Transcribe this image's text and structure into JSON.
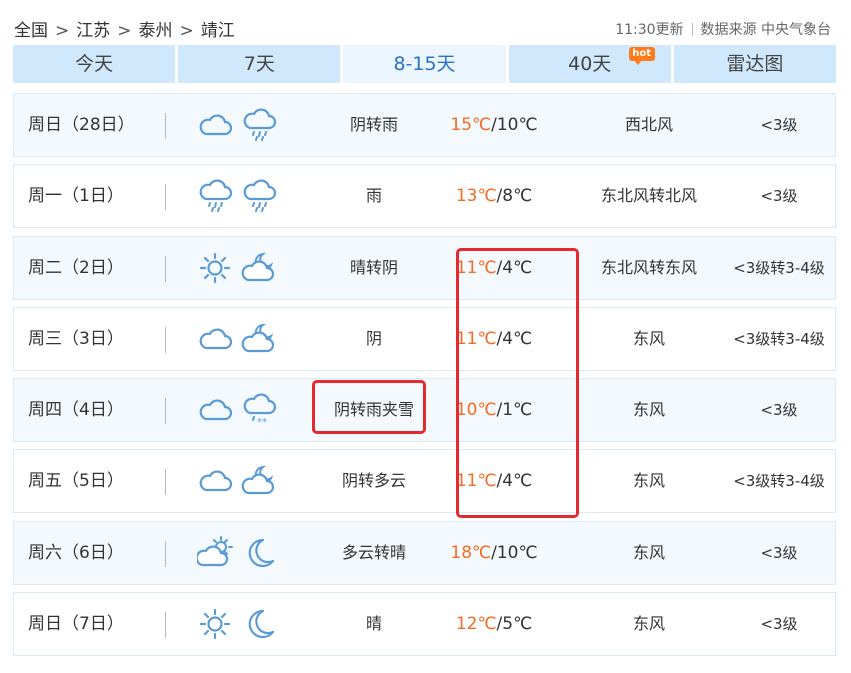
{
  "breadcrumb": [
    "全国",
    "江苏",
    "泰州",
    "靖江"
  ],
  "breadcrumb_sep": ">",
  "meta": {
    "update": "11:30更新",
    "source": "数据来源 中央气象台"
  },
  "tabs": [
    {
      "label": "今天"
    },
    {
      "label": "7天"
    },
    {
      "label": "8-15天",
      "active": true
    },
    {
      "label": "40天",
      "badge": "hot"
    },
    {
      "label": "雷达图"
    }
  ],
  "colors": {
    "tab_bg": "#cfe8fb",
    "tab_active_text": "#2a73c4",
    "high_temp": "#f36c24",
    "highlight": "#e5292f",
    "icon": "#5b9bd5"
  },
  "forecast": [
    {
      "day": "周日（28日）",
      "icons": [
        "cloud-icon",
        "rain-cloud-icon"
      ],
      "weather": "阴转雨",
      "high": "15℃",
      "low": "/10℃",
      "wind": "西北风",
      "level": "<3级"
    },
    {
      "day": "周一（1日）",
      "icons": [
        "rain-cloud-icon",
        "rain-cloud-icon"
      ],
      "weather": "雨",
      "high": "13℃",
      "low": "/8℃",
      "wind": "东北风转北风",
      "level": "<3级"
    },
    {
      "day": "周二（2日）",
      "icons": [
        "sun-icon",
        "moon-cloud-icon"
      ],
      "weather": "晴转阴",
      "high": "11℃",
      "low": "/4℃",
      "wind": "东北风转东风",
      "level": "<3级转3-4级"
    },
    {
      "day": "周三（3日）",
      "icons": [
        "cloud-icon",
        "moon-cloud-icon"
      ],
      "weather": "阴",
      "high": "11℃",
      "low": "/4℃",
      "wind": "东风",
      "level": "<3级转3-4级"
    },
    {
      "day": "周四（4日）",
      "icons": [
        "cloud-icon",
        "sleet-cloud-icon"
      ],
      "weather": "阴转雨夹雪",
      "high": "10℃",
      "low": "/1℃",
      "wind": "东风",
      "level": "<3级"
    },
    {
      "day": "周五（5日）",
      "icons": [
        "cloud-icon",
        "moon-cloud-icon"
      ],
      "weather": "阴转多云",
      "high": "11℃",
      "low": "/4℃",
      "wind": "东风",
      "level": "<3级转3-4级"
    },
    {
      "day": "周六（6日）",
      "icons": [
        "sun-cloud-icon",
        "moon-icon"
      ],
      "weather": "多云转晴",
      "high": "18℃",
      "low": "/10℃",
      "wind": "东风",
      "level": "<3级"
    },
    {
      "day": "周日（7日）",
      "icons": [
        "sun-icon",
        "moon-icon"
      ],
      "weather": "晴",
      "high": "12℃",
      "low": "/5℃",
      "wind": "东风",
      "level": "<3级"
    }
  ]
}
